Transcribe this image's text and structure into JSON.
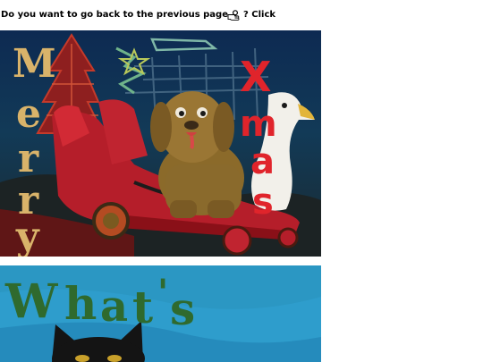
{
  "nav": {
    "question": "Do you want to go back to the previous page",
    "click_label": "? Click",
    "pin_icon": "pin-icon",
    "back_icon": "pointing-hand-icon"
  },
  "paintings": [
    {
      "name": "merry-xmas-painting",
      "lettering": [
        "Merry",
        "Xmas"
      ]
    },
    {
      "name": "whats-painting",
      "lettering": [
        "What's"
      ]
    }
  ]
}
